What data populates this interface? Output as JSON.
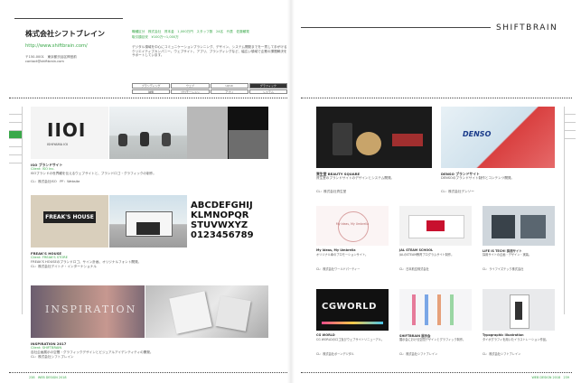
{
  "left_page": {
    "company_name": "株式会社シフトブレイン",
    "url": "http://www.shiftbrain.com/",
    "address_lines": [
      "〒150-0001　東京都渋谷区神宮前",
      "contact@shiftbrain.com"
    ],
    "info_line_1": "職種区分　株式会社　資本金　1,000万円　スタッフ数　24名　代表　佐藤頼晃",
    "info_line_2": "取引額目安　¥100万〜1,000万",
    "description": "デジタル領域を中心にコミュニケーションプランニング、デザイン、システム開発までを一貫して手がけるクリエイティブカンパニー。ウェブサイト、アプリ、ブランディングなど、幅広い領域で企業の課題解決をサポートしています。",
    "tags": [
      "ブランディング",
      "ウェブ",
      "UI/UX",
      "グラフィック",
      "映像",
      "プロモーション",
      "アプリ",
      "システム"
    ],
    "works": [
      {
        "title": "ISO ブランドサイト",
        "credit": "Client: ISO Inc.",
        "body": "ISOブランドの世界観を伝えるウェブサイトと、ブランドロゴ・グラフィックの制作。",
        "cd": "CL：株式会社ISO　PF：Website"
      },
      {
        "title": "FREAK'S HOUSE",
        "credit": "Client: FREAK'S STORE",
        "body": "FREAK'S HOUSEのブランドロゴ、サイン計画、オリジナルフォント開発。",
        "cd": "CL：株式会社デイトナ・インターナショナル"
      },
      {
        "title": "INSPIRATION 2017",
        "credit": "Client: SHIFTBRAIN",
        "body": "自社企画展示の空間・グラフィックデザインとビジュアルアイデンティティの開発。",
        "cd": "CL：株式会社シフトブレイン"
      }
    ],
    "folio": "238　WEB DESIGN 2018"
  },
  "right_page": {
    "brand": "SHIFTBRAIN",
    "works": [
      {
        "title": "資生堂 BEAUTY SQUARE",
        "body": "資生堂のブランドサイトのデザインとシステム開発。",
        "cd": "CL：株式会社資生堂"
      },
      {
        "title": "DENSO ブランドサイト",
        "body": "DENSOのブランドサイト制作とコンテンツ開発。",
        "cd": "CL：株式会社デンソー"
      },
      {
        "title": "My Ideas, My Umbrella",
        "body": "オリジナル傘のプロモーションサイト。",
        "cd": "CL：株式会社ワールドパーティー"
      },
      {
        "title": "JAL STEAM SCHOOL",
        "body": "JALのSTEAM教育プログラムサイト制作。",
        "cd": "CL：日本航空株式会社"
      },
      {
        "title": "LIFE IS TECH! 採用サイト",
        "body": "採用サイトの企画・デザイン・実装。",
        "cd": "CL：ライフイズテック株式会社"
      },
      {
        "title": "CG WORLD",
        "body": "CG WORLDのロゴ及びウェブサイトリニューアル。",
        "cd": "CL：株式会社ボーンデジタル"
      },
      {
        "title": "SHIFTBRAIN 展示会",
        "body": "展示会における空間デザインとグラフィック制作。",
        "cd": "CL：株式会社シフトブレイン"
      },
      {
        "title": "Typographic Illustration",
        "body": "タイポグラフィを用いたイラストレーション作品。",
        "cd": "CL：株式会社シフトブレイン"
      }
    ],
    "folio": "WEB DESIGN 2018　239"
  },
  "logos": {
    "iioi": "IIOI",
    "iioi_sub": "ISHIYAMA IOI",
    "freaks": "FREAK'S HOUSE",
    "alphabet_lines": [
      "ABCDEFGHIJ",
      "KLMNOPQR",
      "STUVWXYZ",
      "0123456789"
    ],
    "cgworld": "CGWORLD",
    "denso": "DENSO",
    "inspiration": "INSPIRATION",
    "umbrella": "My Ideas, My Umbrella"
  },
  "colors": {
    "accent_green": "#3aa84a",
    "rule": "#444444",
    "dark_panel": "#1b1b1b"
  }
}
